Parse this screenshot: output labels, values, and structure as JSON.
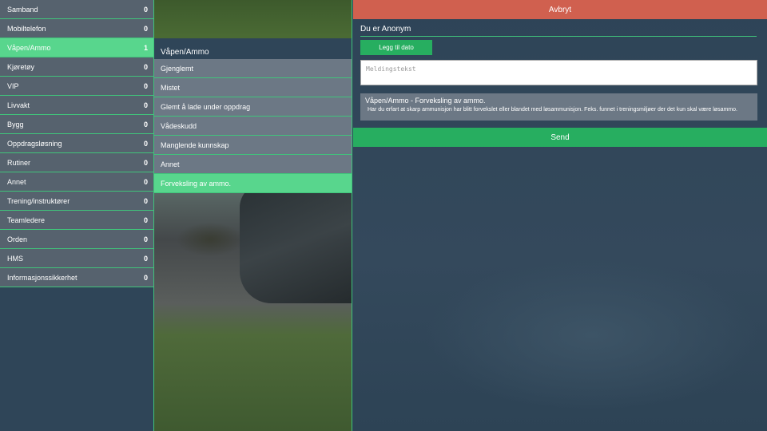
{
  "categories": [
    {
      "label": "Samband",
      "count": "0"
    },
    {
      "label": "Mobiltelefon",
      "count": "0"
    },
    {
      "label": "Våpen/Ammo",
      "count": "1"
    },
    {
      "label": "Kjøretøy",
      "count": "0"
    },
    {
      "label": "VIP",
      "count": "0"
    },
    {
      "label": "Livvakt",
      "count": "0"
    },
    {
      "label": "Bygg",
      "count": "0"
    },
    {
      "label": "Oppdragsløsning",
      "count": "0"
    },
    {
      "label": "Rutiner",
      "count": "0"
    },
    {
      "label": "Annet",
      "count": "0"
    },
    {
      "label": "Trening/instruktører",
      "count": "0"
    },
    {
      "label": "Teamledere",
      "count": "0"
    },
    {
      "label": "Orden",
      "count": "0"
    },
    {
      "label": "HMS",
      "count": "0"
    },
    {
      "label": "Informasjonssikkerhet",
      "count": "0"
    }
  ],
  "active_category_index": 2,
  "subcategory": {
    "title": "Våpen/Ammo",
    "items": [
      "Gjenglemt",
      "Mistet",
      "Glemt å lade under oppdrag",
      "Vådeskudd",
      "Manglende kunnskap",
      "Annet",
      "Forveksling av ammo."
    ],
    "active_index": 6
  },
  "form": {
    "cancel_label": "Avbryt",
    "user_title": "Du er Anonym",
    "add_date_label": "Legg til dato",
    "message_placeholder": "Meldingstekst",
    "info_title": "Våpen/Ammo - Forveksling av ammo.",
    "info_text": "Har du erfart at skarp ammunisjon har blitt forvekslet eller blandet med løsammunisjon. Feks. funnet i treningsmiljøer der det kun skal være løsammo.",
    "send_label": "Send"
  },
  "colors": {
    "accent_green": "#58d68d",
    "button_green": "#27ae60",
    "cancel_red": "#d0604f",
    "item_gray": "#56626e",
    "panel_navy": "#2f4558"
  }
}
